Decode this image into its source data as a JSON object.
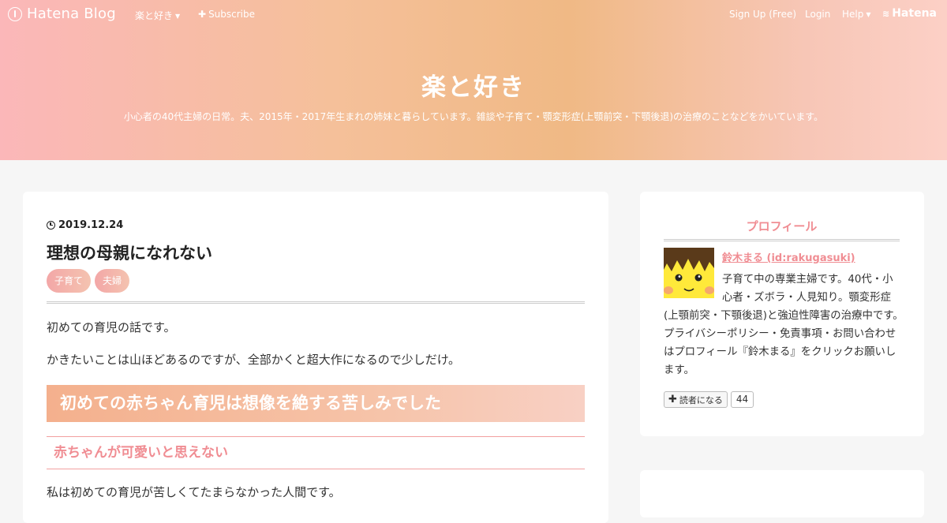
{
  "nav": {
    "brand": "Hatena Blog",
    "blog_menu": "楽と好き",
    "subscribe": "Subscribe",
    "signup": "Sign Up (Free)",
    "login": "Login",
    "help": "Help",
    "hatena": "Hatena"
  },
  "blog": {
    "title": "楽と好き",
    "description": "小心者の40代主婦の日常。夫、2015年・2017年生まれの姉妹と暮らしています。雑談や子育て・顎変形症(上顎前突・下顎後退)の治療のことなどをかいています。"
  },
  "entry": {
    "date": "2019.12.24",
    "title": "理想の母親になれない",
    "tags": [
      "子育て",
      "夫婦"
    ],
    "para1": "初めての育児の話です。",
    "para2": "かきたいことは山ほどあるのですが、全部かくと超大作になるので少しだけ。",
    "heading3": "初めての赤ちゃん育児は想像を絶する苦しみでした",
    "heading4": "赤ちゃんが可愛いと思えない",
    "para3": "私は初めての育児が苦しくてたまらなかった人間です。"
  },
  "profile": {
    "section_title": "プロフィール",
    "author": "鈴木まる (id:rakugasuki)",
    "bio_line1": "子育て中の専業主婦です。40代・小",
    "bio_line2": "心者・ズボラ・人見知り。顎変形症",
    "bio_rest": "(上顎前突・下顎後退)と強迫性障害の治療中です。プライバシーポリシー・免責事項・お問い合わせはプロフィール『鈴木まる』をクリックお願いします。",
    "reader_button": "読者になる",
    "reader_count": "44"
  },
  "colors": {
    "accent": "#f08d93",
    "header_gradient": [
      "#fbb7b9",
      "#f0b985",
      "#fcd0c6"
    ],
    "page_bg": "#f6f6f6"
  }
}
